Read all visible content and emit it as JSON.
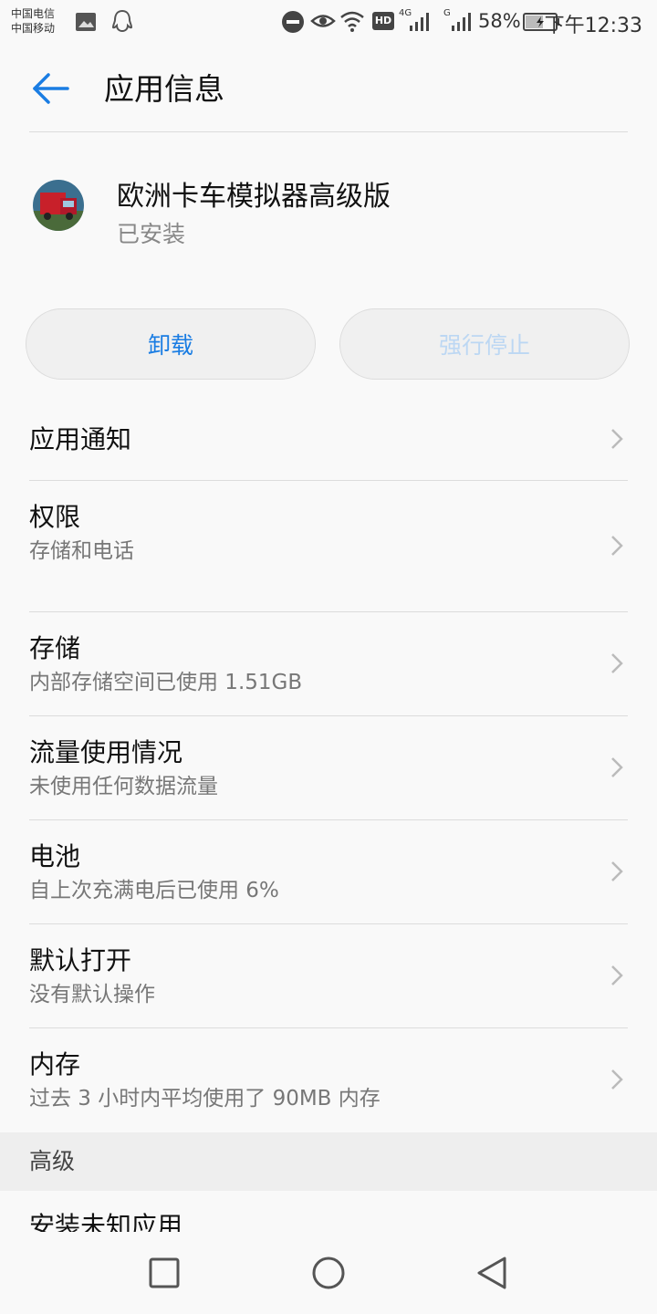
{
  "status_bar": {
    "carrier1": "中国电信",
    "carrier2": "中国移动",
    "net1": "4G",
    "net2": "G",
    "hd": "HD",
    "battery": "58%",
    "time": "下午12:33",
    "icons": [
      "gallery-icon",
      "qq-icon",
      "do-not-disturb-icon",
      "eye-comfort-icon",
      "wifi-icon",
      "hd-icon",
      "signal-icon",
      "signal-icon",
      "battery-charging-icon"
    ]
  },
  "header": {
    "title": "应用信息",
    "back_icon": "arrow-left-icon"
  },
  "app": {
    "name": "欧洲卡车模拟器高级版",
    "status": "已安装",
    "icon": "truck-app-icon"
  },
  "buttons": {
    "uninstall": "卸载",
    "force_stop": "强行停止"
  },
  "items": [
    {
      "title": "应用通知",
      "subtitle": ""
    },
    {
      "title": "权限",
      "subtitle": "存储和电话"
    },
    {
      "title": "存储",
      "subtitle": "内部存储空间已使用 1.51GB"
    },
    {
      "title": "流量使用情况",
      "subtitle": "未使用任何数据流量"
    },
    {
      "title": "电池",
      "subtitle": "自上次充满电后已使用 6%"
    },
    {
      "title": "默认打开",
      "subtitle": "没有默认操作"
    },
    {
      "title": "内存",
      "subtitle": "过去 3 小时内平均使用了 90MB 内存"
    }
  ],
  "section": {
    "advanced": "高级"
  },
  "advanced_items": [
    {
      "title": "安装未知应用"
    }
  ],
  "colors": {
    "accent": "#1a7de3",
    "disabled": "#bcd7f3",
    "background": "#f9f9f9"
  }
}
